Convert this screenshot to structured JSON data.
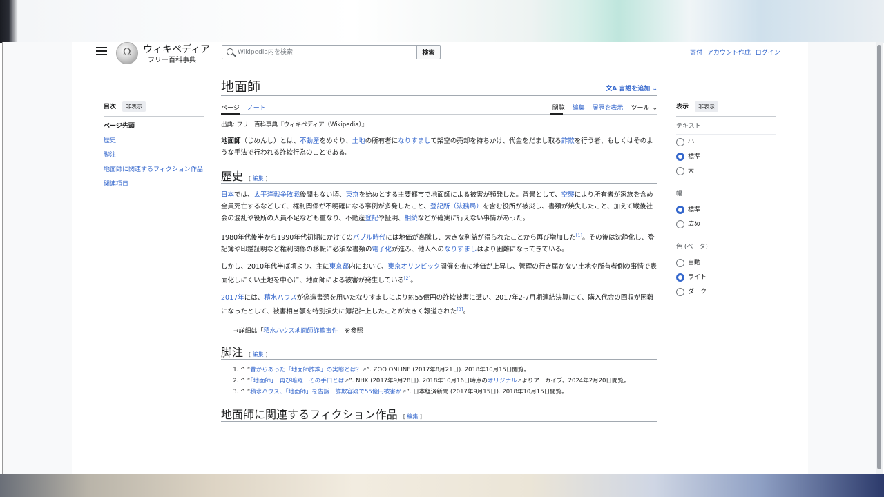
{
  "header": {
    "logo_name": "ウィキペディア",
    "logo_tagline": "フリー百科事典",
    "search_placeholder": "Wikipedia内を検索",
    "search_button": "検索",
    "links": [
      "寄付",
      "アカウント作成",
      "ログイン"
    ]
  },
  "toc": {
    "heading": "目次",
    "hide": "非表示",
    "items": [
      "ページ先頭",
      "歴史",
      "脚注",
      "地面師に関連するフィクション作品",
      "関連項目"
    ]
  },
  "article": {
    "title": "地面師",
    "add_languages": "言語を追加",
    "tabs_left": [
      "ページ",
      "ノート"
    ],
    "tabs_right": [
      "閲覧",
      "編集",
      "履歴を表示",
      "ツール"
    ],
    "source_line": "出典: フリー百科事典『ウィキペディア（Wikipedia）』",
    "edit_label": "編集",
    "lead": {
      "bold": "地面師",
      "t1": "（じめんし）とは、",
      "l1": "不動産",
      "t2": "をめぐり、",
      "l2": "土地",
      "t3": "の所有者に",
      "l3": "なりすまし",
      "t4": "て架空の売却を持ちかけ、代金をだまし取る",
      "l4": "詐欺",
      "t5": "を行う者、もしくはそのような手法で行われる詐欺行為のことである。"
    },
    "history_heading": "歴史",
    "history_p1": {
      "l1": "日本",
      "t1": "では、",
      "l2": "太平洋戦争敗戦",
      "t2": "後間もない頃、",
      "l3": "東京",
      "t3": "を始めとする主要都市で地面師による被害が頻発した。背景として、",
      "l4": "空襲",
      "t4": "により所有者が家族を含め全員死亡するなどして、権利関係が不明確になる事例が多発したこと、",
      "l5": "登記所（法務局）",
      "t5": "を含む役所が被災し、書類が焼失したこと、加えて戦後社会の混乱や役所の人員不足なども重なり、不動産",
      "l6": "登記",
      "t6": "や証明、",
      "l7": "相続",
      "t7": "などが確実に行えない事情があった。"
    },
    "history_p2": {
      "t1": "1980年代後半から1990年代初期にかけての",
      "l1": "バブル時代",
      "t2": "には地価が高騰し、大きな利益が得られたことから再び増加した",
      "r1": "[1]",
      "t3": "。その後は沈静化し、登記簿や印鑑証明など権利関係の移転に必須な書類の",
      "l2": "電子化",
      "t4": "が進み、他人への",
      "l3": "なりすまし",
      "t5": "はより困難になってきている。"
    },
    "history_p3": {
      "t1": "しかし、2010年代半ば頃より、主に",
      "l1": "東京都",
      "t2": "内において、",
      "l2": "東京オリンピック",
      "t3": "開催を機に地価が上昇し、管理の行き届かない土地や所有者側の事情で表面化しにくい土地を中心に、地面師による被害が発生している",
      "r1": "[2]",
      "t4": "。"
    },
    "history_p4": {
      "l1": "2017年",
      "t1": "には、",
      "l2": "積水ハウス",
      "t2": "が偽造書類を用いたなりすましにより約55億円の詐欺被害に遭い、2017年2-7月期連結決算にて、購入代金の回収が困難になったとして、被害相当額を特別損失に簿記計上したことが大きく報道された",
      "r1": "[3]",
      "t3": "。"
    },
    "see_also": {
      "t1": "→詳細は「",
      "l1": "積水ハウス地面師詐欺事件",
      "t2": "」を参照"
    },
    "footnotes_heading": "脚注",
    "refs": [
      {
        "pre": "^ “",
        "link": "昔からあった「地面師詐欺」の実態とは？",
        "post": "”. ZOO ONLINE (2017年8月21日). 2018年10月15日閲覧。"
      },
      {
        "pre": "^ “",
        "link": "「地面師」　再び暗躍　その手口とは",
        "post": "”. NHK (2017年9月28日). 2018年10月16日時点の",
        "link2": "オリジナル",
        "post2": "よりアーカイブ。2024年2月20日閲覧。"
      },
      {
        "pre": "^ “",
        "link": "積水ハウス、「地面師」を告訴　詐欺容疑で55億円被害か",
        "post": "”. 日本経済新聞 (2017年9月15日). 2018年10月15日閲覧。"
      }
    ],
    "fiction_heading": "地面師に関連するフィクション作品"
  },
  "appearance": {
    "heading": "表示",
    "hide": "非表示",
    "text_label": "テキスト",
    "text_options": [
      "小",
      "標準",
      "大"
    ],
    "width_label": "幅",
    "width_options": [
      "標準",
      "広め"
    ],
    "color_label": "色 (ベータ)",
    "color_options": [
      "自動",
      "ライト",
      "ダーク"
    ]
  },
  "colors": {
    "link": "#3366cc",
    "text": "#202122",
    "radio_on": "#3366cc"
  }
}
